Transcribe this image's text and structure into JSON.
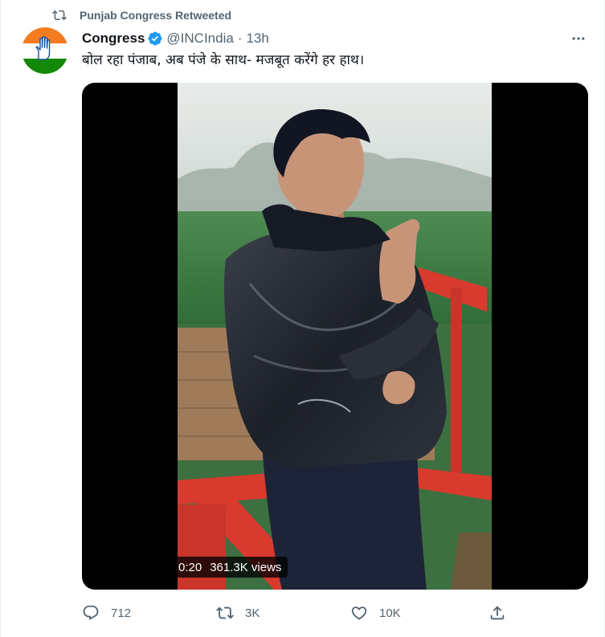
{
  "retweet": {
    "icon": "retweet-icon",
    "text": "Punjab Congress Retweeted"
  },
  "author": {
    "avatar_icon": "congress-hand-logo-icon",
    "name": "Congress",
    "verified_icon": "verified-badge-icon",
    "handle": "@INCIndia",
    "separator": "·",
    "time": "13h"
  },
  "more_icon": "more-options-icon",
  "tweet_text": "बोल रहा पंजाब, अब पंजे के साथ- मजबूत करेंगे हर हाथ।",
  "media": {
    "duration": "0:20",
    "views": "361.3K views"
  },
  "actions": [
    {
      "icon": "reply-icon",
      "count": "712"
    },
    {
      "icon": "retweet-icon",
      "count": "3K"
    },
    {
      "icon": "like-icon",
      "count": "10K"
    },
    {
      "icon": "share-icon",
      "count": ""
    }
  ],
  "colors": {
    "text_primary": "#0f1419",
    "text_secondary": "#536471",
    "verified_blue": "#1d9bf0",
    "saffron": "#f47b20",
    "green": "#138808"
  }
}
